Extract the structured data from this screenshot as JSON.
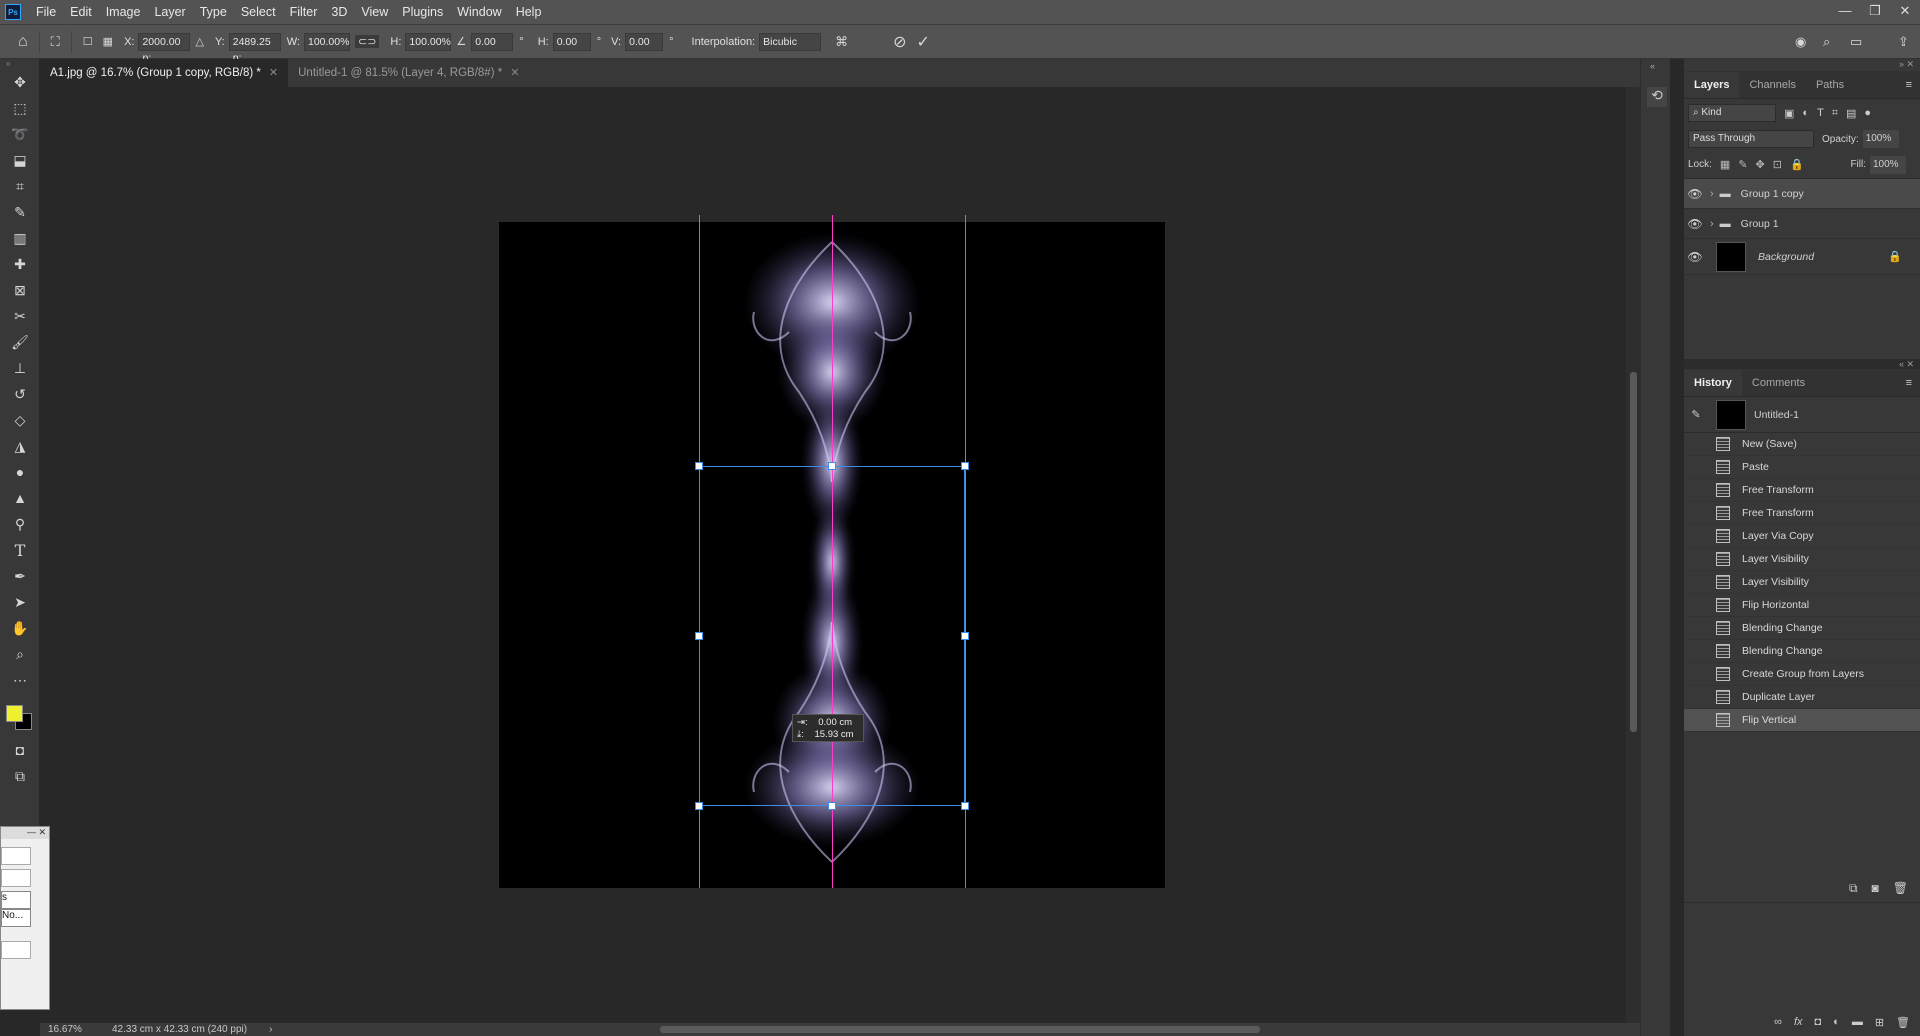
{
  "app": {
    "logo": "Ps"
  },
  "menu": [
    "File",
    "Edit",
    "Image",
    "Layer",
    "Type",
    "Select",
    "Filter",
    "3D",
    "View",
    "Plugins",
    "Window",
    "Help"
  ],
  "window_controls": {
    "minimize": "—",
    "restore": "❐",
    "close": "✕"
  },
  "options": {
    "x_label": "X:",
    "x_value": "2000.00 p:",
    "y_label": "Y:",
    "y_value": "2489.25 p:",
    "w_label": "W:",
    "w_value": "100.00%",
    "h_label": "H:",
    "h_value": "100.00%",
    "angle_value": "0.00",
    "angle_unit": "°",
    "hskew_label": "H:",
    "hskew_value": "0.00",
    "hskew_unit": "°",
    "vskew_label": "V:",
    "vskew_value": "0.00",
    "vskew_unit": "°",
    "interp_label": "Interpolation:",
    "interp_value": "Bicubic"
  },
  "tabs": [
    {
      "label": "A1.jpg @ 16.7% (Group 1 copy, RGB/8) *",
      "active": true
    },
    {
      "label": "Untitled-1 @ 81.5% (Layer 4, RGB/8#) *",
      "active": false
    }
  ],
  "transform_readout": {
    "dx": "0.00 cm",
    "dy": "15.93 cm"
  },
  "layers_panel": {
    "tabs": [
      "Layers",
      "Channels",
      "Paths"
    ],
    "filter_kind": "Kind",
    "blend_mode": "Pass Through",
    "opacity_label": "Opacity:",
    "opacity_value": "100%",
    "lock_label": "Lock:",
    "fill_label": "Fill:",
    "fill_value": "100%",
    "layers": [
      {
        "name": "Group 1 copy",
        "type": "group",
        "selected": true
      },
      {
        "name": "Group 1",
        "type": "group",
        "selected": false
      },
      {
        "name": "Background",
        "type": "image",
        "selected": false
      }
    ]
  },
  "history_panel": {
    "tabs": [
      "History",
      "Comments"
    ],
    "snapshot": "Untitled-1",
    "states": [
      "New (Save)",
      "Paste",
      "Free Transform",
      "Free Transform",
      "Layer Via Copy",
      "Layer Visibility",
      "Layer Visibility",
      "Flip Horizontal",
      "Blending Change",
      "Blending Change",
      "Create Group from Layers",
      "Duplicate Layer",
      "Flip Vertical"
    ],
    "selected_index": 12
  },
  "status": {
    "zoom": "16.67%",
    "doc_size": "42.33 cm x 42.33 cm (240 ppi)"
  },
  "dialog": {
    "line1": "s",
    "line2": "No..."
  },
  "colors": {
    "foreground": "#f0f032",
    "background": "#000000",
    "guide": "#ff3dc8",
    "bbox": "#3a8ee6"
  }
}
